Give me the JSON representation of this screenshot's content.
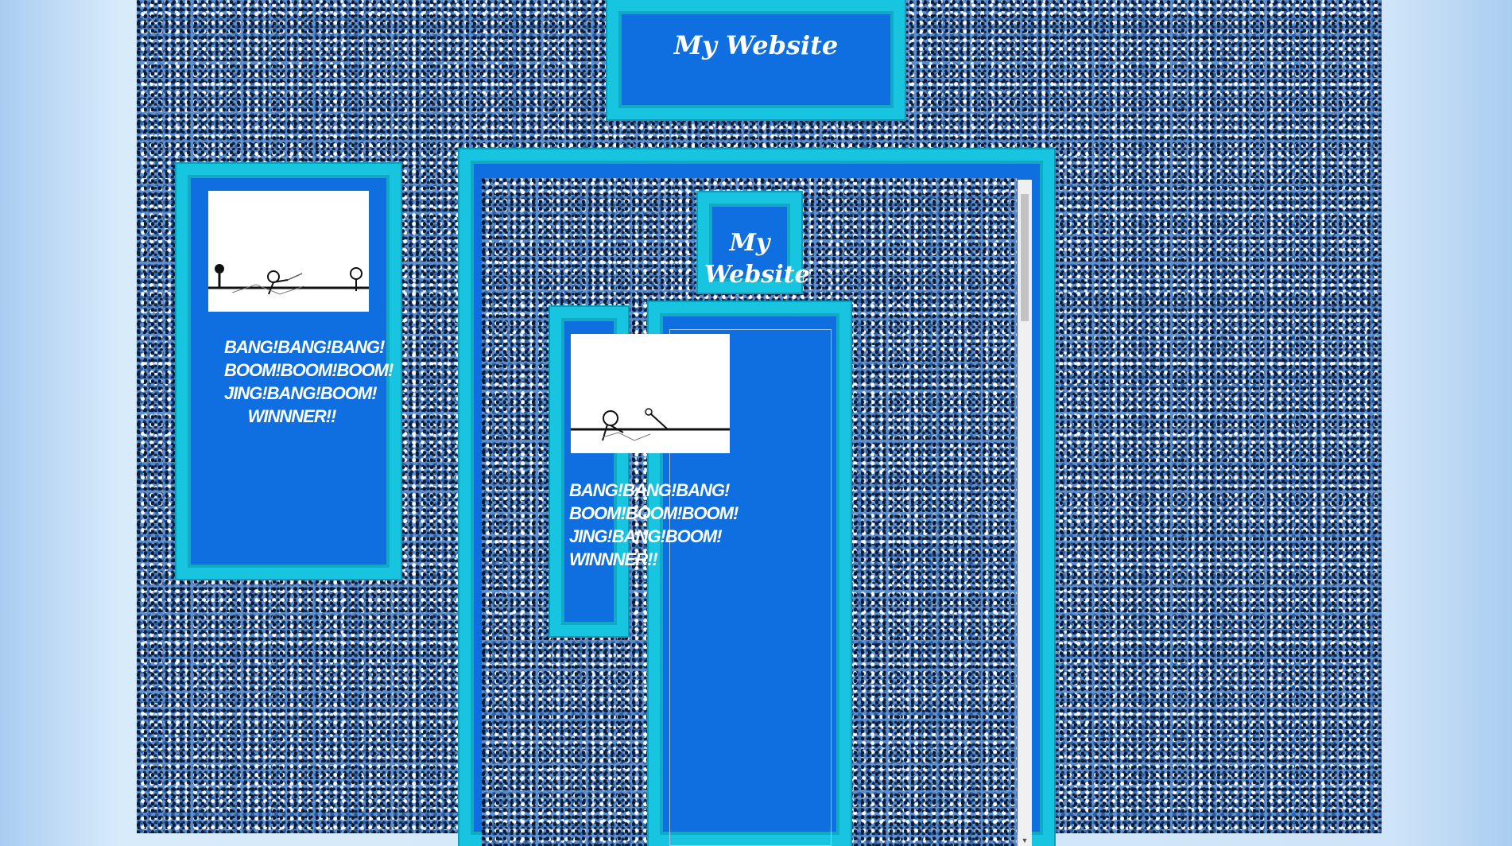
{
  "site": {
    "title": "My Website",
    "inner_title": "My Website"
  },
  "left_panel": {
    "caption_lines": [
      "BANG!BANG!BANG!",
      "BOOM!BOOM!BOOM!",
      "JING!BANG!BOOM!",
      "WINNNER!!"
    ]
  },
  "inner_panel": {
    "caption_lines": [
      "BANG!BANG!BANG!",
      "BOOM!BOOM!BOOM!",
      "JING!BANG!BOOM!",
      "WINNNER!!"
    ]
  },
  "icons": {
    "scroll_down": "scroll-down-arrow-icon"
  },
  "colors": {
    "frame": "#18c5e0",
    "panel": "#0f6fe0",
    "text": "#ffffff"
  }
}
